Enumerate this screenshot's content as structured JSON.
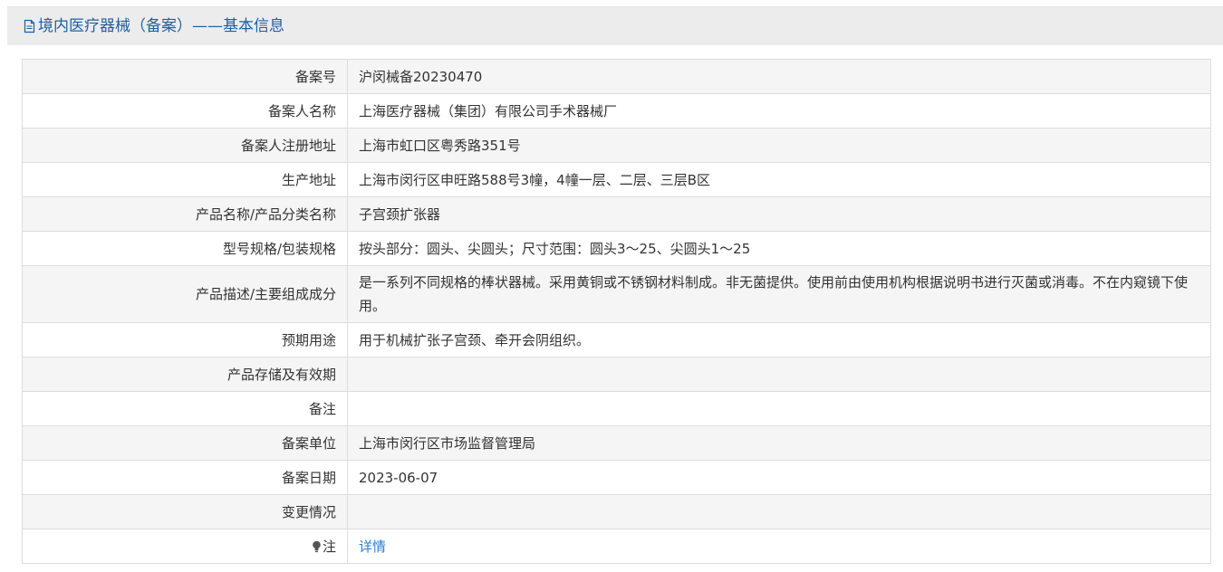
{
  "header": {
    "title": "境内医疗器械（备案）——基本信息",
    "icon": "document-icon"
  },
  "rows": [
    {
      "label": "备案号",
      "value": "沪闵械备20230470"
    },
    {
      "label": "备案人名称",
      "value": "上海医疗器械（集团）有限公司手术器械厂"
    },
    {
      "label": "备案人注册地址",
      "value": "上海市虹口区粤秀路351号"
    },
    {
      "label": "生产地址",
      "value": "上海市闵行区申旺路588号3幢，4幢一层、二层、三层B区"
    },
    {
      "label": "产品名称/产品分类名称",
      "value": "子宫颈扩张器"
    },
    {
      "label": "型号规格/包装规格",
      "value": "按头部分：圆头、尖圆头；尺寸范围：圆头3～25、尖圆头1～25"
    },
    {
      "label": "产品描述/主要组成成分",
      "value": "是一系列不同规格的棒状器械。采用黄铜或不锈钢材料制成。非无菌提供。使用前由使用机构根据说明书进行灭菌或消毒。不在内窥镜下使用。"
    },
    {
      "label": "预期用途",
      "value": "用于机械扩张子宫颈、牵开会阴组织。"
    },
    {
      "label": "产品存储及有效期",
      "value": ""
    },
    {
      "label": "备注",
      "value": ""
    },
    {
      "label": "备案单位",
      "value": "上海市闵行区市场监督管理局"
    },
    {
      "label": "备案日期",
      "value": "2023-06-07"
    },
    {
      "label": "变更情况",
      "value": ""
    }
  ],
  "note": {
    "label": "注",
    "icon": "lightbulb-icon",
    "link": "详情"
  },
  "colors": {
    "header_text": "#1f5f9f",
    "link": "#2a7fd0",
    "stripe": "#f5f5f5",
    "border": "#dddddd"
  }
}
